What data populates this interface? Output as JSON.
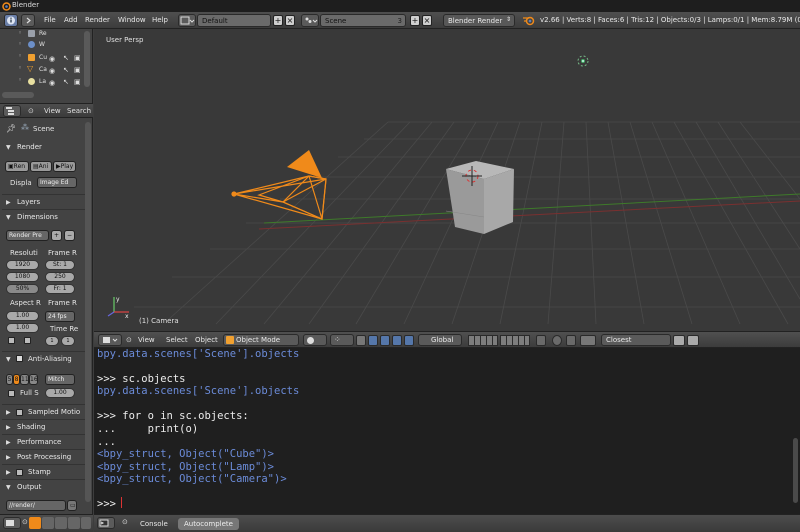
{
  "window": {
    "title": "Blender"
  },
  "info_header": {
    "menus": [
      "File",
      "Add",
      "Render",
      "Window",
      "Help"
    ],
    "screen_layout": "Default",
    "scene": "Scene",
    "scene_users": "3",
    "render_engine": "Blender Render",
    "stats": "v2.66 | Verts:8 | Faces:6 | Tris:12 | Objects:0/3 | Lamps:0/1 | Mem:8.79M (0.11M)"
  },
  "outliner": {
    "items": [
      {
        "label": "Re",
        "icon": "render-layers-icon"
      },
      {
        "label": "W",
        "icon": "world-icon"
      },
      {
        "label": "Cu",
        "icon": "cube-object-icon"
      },
      {
        "label": "Ca",
        "icon": "camera-object-icon"
      },
      {
        "label": "La",
        "icon": "lamp-object-icon"
      }
    ],
    "header": {
      "view": "View",
      "search": "Search"
    }
  },
  "properties": {
    "breadcrumb": "Scene",
    "render_panel": {
      "title": "Render",
      "buttons": [
        "Ren",
        "Ani",
        "Play"
      ],
      "display_label": "Displa",
      "display_value": "Image Ed"
    },
    "layers_panel": "Layers",
    "dimensions_panel": {
      "title": "Dimensions",
      "preset": "Render Pre",
      "resolution_label": "Resoluti",
      "frame_range_label": "Frame R",
      "res_x": "1920",
      "res_y": "1080",
      "res_pct": "50%",
      "frame_start": "St: 1",
      "frame_end": "250",
      "frame_step": "Fr: 1",
      "aspect_label": "Aspect R",
      "frame_rate_label": "Frame R",
      "aspect_x": "1.00",
      "aspect_y": "1.00",
      "fps": "24 fps",
      "time_remap_label": "Time Re",
      "time_old": "1",
      "time_new": "1"
    },
    "anti_aliasing": {
      "title": "Anti-Aliasing",
      "samples": [
        "5",
        "8",
        "11",
        "16"
      ],
      "filter": "Mitch",
      "full_sample": "Full S",
      "filter_size": "1.00"
    },
    "collapsed_panels": [
      "Sampled Motio",
      "Shading",
      "Performance",
      "Post Processing",
      "Stamp"
    ],
    "output_panel": {
      "title": "Output",
      "path": "//render/"
    }
  },
  "viewport": {
    "view_name": "User Persp",
    "object_name": "(1) Camera",
    "header": {
      "view": "View",
      "select": "Select",
      "object": "Object",
      "mode": "Object Mode",
      "orientation": "Global",
      "snap": "Closest"
    },
    "colors": {
      "selected": "#f08a1a",
      "grid": "#4a4a4a",
      "x_axis": "#8a3a3a",
      "y_axis": "#3e7a2a"
    }
  },
  "console": {
    "lines": [
      {
        "text": "bpy.data.scenes['Scene'].objects",
        "style": "blue"
      },
      {
        "text": "",
        "style": "white"
      },
      {
        "text": ">>> sc.objects",
        "style": "white"
      },
      {
        "text": "bpy.data.scenes['Scene'].objects",
        "style": "blue"
      },
      {
        "text": "",
        "style": "white"
      },
      {
        "text": ">>> for o in sc.objects:",
        "style": "white"
      },
      {
        "text": "...     print(o)",
        "style": "white"
      },
      {
        "text": "...",
        "style": "white"
      },
      {
        "text": "<bpy_struct, Object(\"Cube\")>",
        "style": "blue"
      },
      {
        "text": "<bpy_struct, Object(\"Lamp\")>",
        "style": "blue"
      },
      {
        "text": "<bpy_struct, Object(\"Camera\")>",
        "style": "blue"
      },
      {
        "text": "",
        "style": "white"
      },
      {
        "text": ">>> ",
        "style": "white"
      }
    ],
    "tabs": {
      "console": "Console",
      "autocomplete": "Autocomplete"
    }
  }
}
